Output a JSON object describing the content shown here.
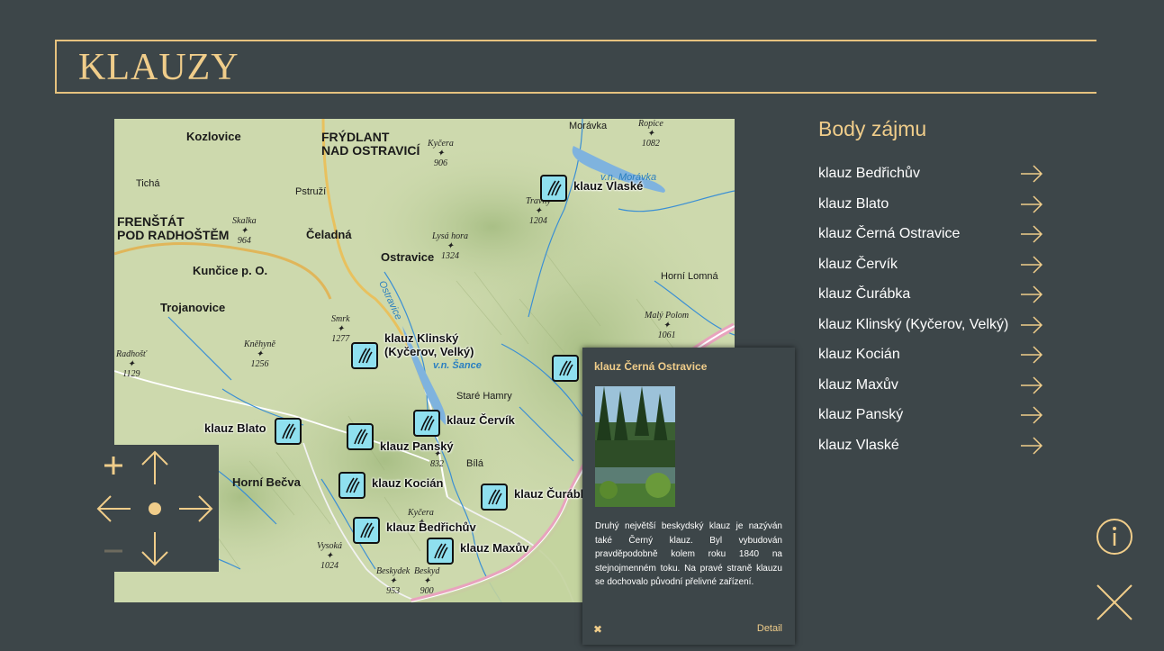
{
  "header": {
    "title": "KLAUZY"
  },
  "map": {
    "places": [
      {
        "label": "Kozlovice"
      },
      {
        "label": "FRÝDLANT"
      },
      {
        "label": "NAD OSTRAVICÍ"
      },
      {
        "label": "Morávka"
      },
      {
        "label": "Tichá"
      },
      {
        "label": "Pstruží"
      },
      {
        "label": "FRENŠTÁT"
      },
      {
        "label": "POD RADHOŠTĚM"
      },
      {
        "label": "Čeladná"
      },
      {
        "label": "Ostravice"
      },
      {
        "label": "Kunčice p. O."
      },
      {
        "label": "Trojanovice"
      },
      {
        "label": "Horní Lomná"
      },
      {
        "label": "Staré Hamry"
      },
      {
        "label": "Horní Bečva"
      },
      {
        "label": "Bílá"
      }
    ],
    "peaks": [
      {
        "name": "Kyčera",
        "elev": "906"
      },
      {
        "name": "Ropice",
        "elev": "1082"
      },
      {
        "name": "Travný",
        "elev": "1204"
      },
      {
        "name": "Skalka",
        "elev": "964"
      },
      {
        "name": "Lysá hora",
        "elev": "1324"
      },
      {
        "name": "Smrk",
        "elev": "1277"
      },
      {
        "name": "Kněhyně",
        "elev": "1256"
      },
      {
        "name": "Radhošť",
        "elev": "1129"
      },
      {
        "name": "Malý Polom",
        "elev": "1061"
      },
      {
        "name": "Kyčera",
        "elev": ""
      },
      {
        "name": "Vysoká",
        "elev": "1024"
      },
      {
        "name": "Beskydek",
        "elev": "953"
      },
      {
        "name": "Beskyd",
        "elev": "900"
      }
    ],
    "rivers": {
      "ostravice": "Ostravice",
      "sance": "v.n. Šance",
      "moravka": "v.n. Morávka"
    },
    "markers": [
      {
        "label": "klauz Vlaské"
      },
      {
        "label": "klauz Klinský\n(Kyčerov, Velký)"
      },
      {
        "label": "klauz Blato"
      },
      {
        "label": "klauz Červík"
      },
      {
        "label": "klauz Panský"
      },
      {
        "label": "klauz Kocián"
      },
      {
        "label": "klauz Čurábka"
      },
      {
        "label": "klauz Bedřichův"
      },
      {
        "label": "klauz Maxův"
      },
      {
        "label": ""
      }
    ],
    "peak_extra": {
      "panskyElev": "832"
    }
  },
  "popup": {
    "title": "klauz Černá Ostravice",
    "description": "Druhý největší beskydský klauz je nazýván také Černý klauz. Byl vybudován pravděpodobně kolem roku 1840 na stejnojmenném toku. Na pravé straně klauzu se dochovalo původní přelivné zařízení.",
    "close_symbol": "✖",
    "detail_label": "Detail"
  },
  "poi": {
    "title": "Body zájmu",
    "items": [
      {
        "label": "klauz Bedřichův"
      },
      {
        "label": "klauz Blato"
      },
      {
        "label": "klauz Černá Ostravice"
      },
      {
        "label": "klauz Červík"
      },
      {
        "label": "klauz Čurábka"
      },
      {
        "label": "klauz Klinský (Kyčerov, Velký)"
      },
      {
        "label": "klauz Kocián"
      },
      {
        "label": "klauz Maxův"
      },
      {
        "label": "klauz Panský"
      },
      {
        "label": "klauz Vlaské"
      }
    ]
  },
  "colors": {
    "background": "#3d4649",
    "accent": "#f0cd8a",
    "marker": "#8fe0ef"
  },
  "icons": {
    "zoom_in": "plus-icon",
    "zoom_out": "minus-icon",
    "pan_up": "arrow-up-icon",
    "pan_down": "arrow-down-icon",
    "pan_left": "arrow-left-icon",
    "pan_right": "arrow-right-icon",
    "center": "center-dot-icon",
    "info": "info-icon",
    "close": "close-icon",
    "poi_arrow": "arrow-right-icon"
  }
}
